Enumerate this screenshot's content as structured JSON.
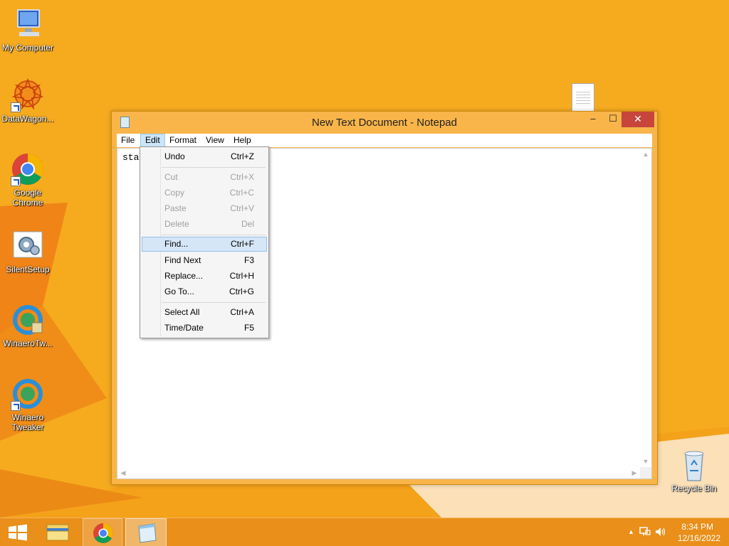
{
  "desktop": {
    "icons": [
      {
        "label": "My Computer",
        "icon": "computer-icon"
      },
      {
        "label": "DataWagon...",
        "icon": "datawagon-icon"
      },
      {
        "label": "Google Chrome",
        "icon": "chrome-icon"
      },
      {
        "label": "SilentSetup",
        "icon": "setup-gear-icon"
      },
      {
        "label": "WinaeroTw...",
        "icon": "winaero-icon"
      },
      {
        "label": "Winaero Tweaker",
        "icon": "winaero-icon"
      },
      {
        "label": "Recycle Bin",
        "icon": "recycle-bin-icon"
      }
    ],
    "background_color": "#f5a81c"
  },
  "window": {
    "title": "New Text Document - Notepad",
    "minimize": "‒",
    "maximize": "☐",
    "close": "✕",
    "menu": [
      "File",
      "Edit",
      "Format",
      "View",
      "Help"
    ],
    "active_menu": "Edit",
    "content_text": "sta"
  },
  "edit_menu": {
    "items": [
      {
        "label": "Undo",
        "shortcut": "Ctrl+Z",
        "enabled": true
      },
      {
        "label": "Cut",
        "shortcut": "Ctrl+X",
        "enabled": false
      },
      {
        "label": "Copy",
        "shortcut": "Ctrl+C",
        "enabled": false
      },
      {
        "label": "Paste",
        "shortcut": "Ctrl+V",
        "enabled": false
      },
      {
        "label": "Delete",
        "shortcut": "Del",
        "enabled": false
      },
      {
        "label": "Find...",
        "shortcut": "Ctrl+F",
        "enabled": true,
        "highlighted": true
      },
      {
        "label": "Find Next",
        "shortcut": "F3",
        "enabled": true
      },
      {
        "label": "Replace...",
        "shortcut": "Ctrl+H",
        "enabled": true
      },
      {
        "label": "Go To...",
        "shortcut": "Ctrl+G",
        "enabled": true
      },
      {
        "label": "Select All",
        "shortcut": "Ctrl+A",
        "enabled": true
      },
      {
        "label": "Time/Date",
        "shortcut": "F5",
        "enabled": true
      }
    ]
  },
  "taskbar": {
    "buttons": [
      "start-button",
      "file-explorer-icon",
      "chrome-icon",
      "notepad-icon"
    ],
    "tray": {
      "time": "8:34 PM",
      "date": "12/16/2022",
      "icons": [
        "show-hidden-icons-icon",
        "network-icon",
        "volume-icon"
      ]
    }
  }
}
